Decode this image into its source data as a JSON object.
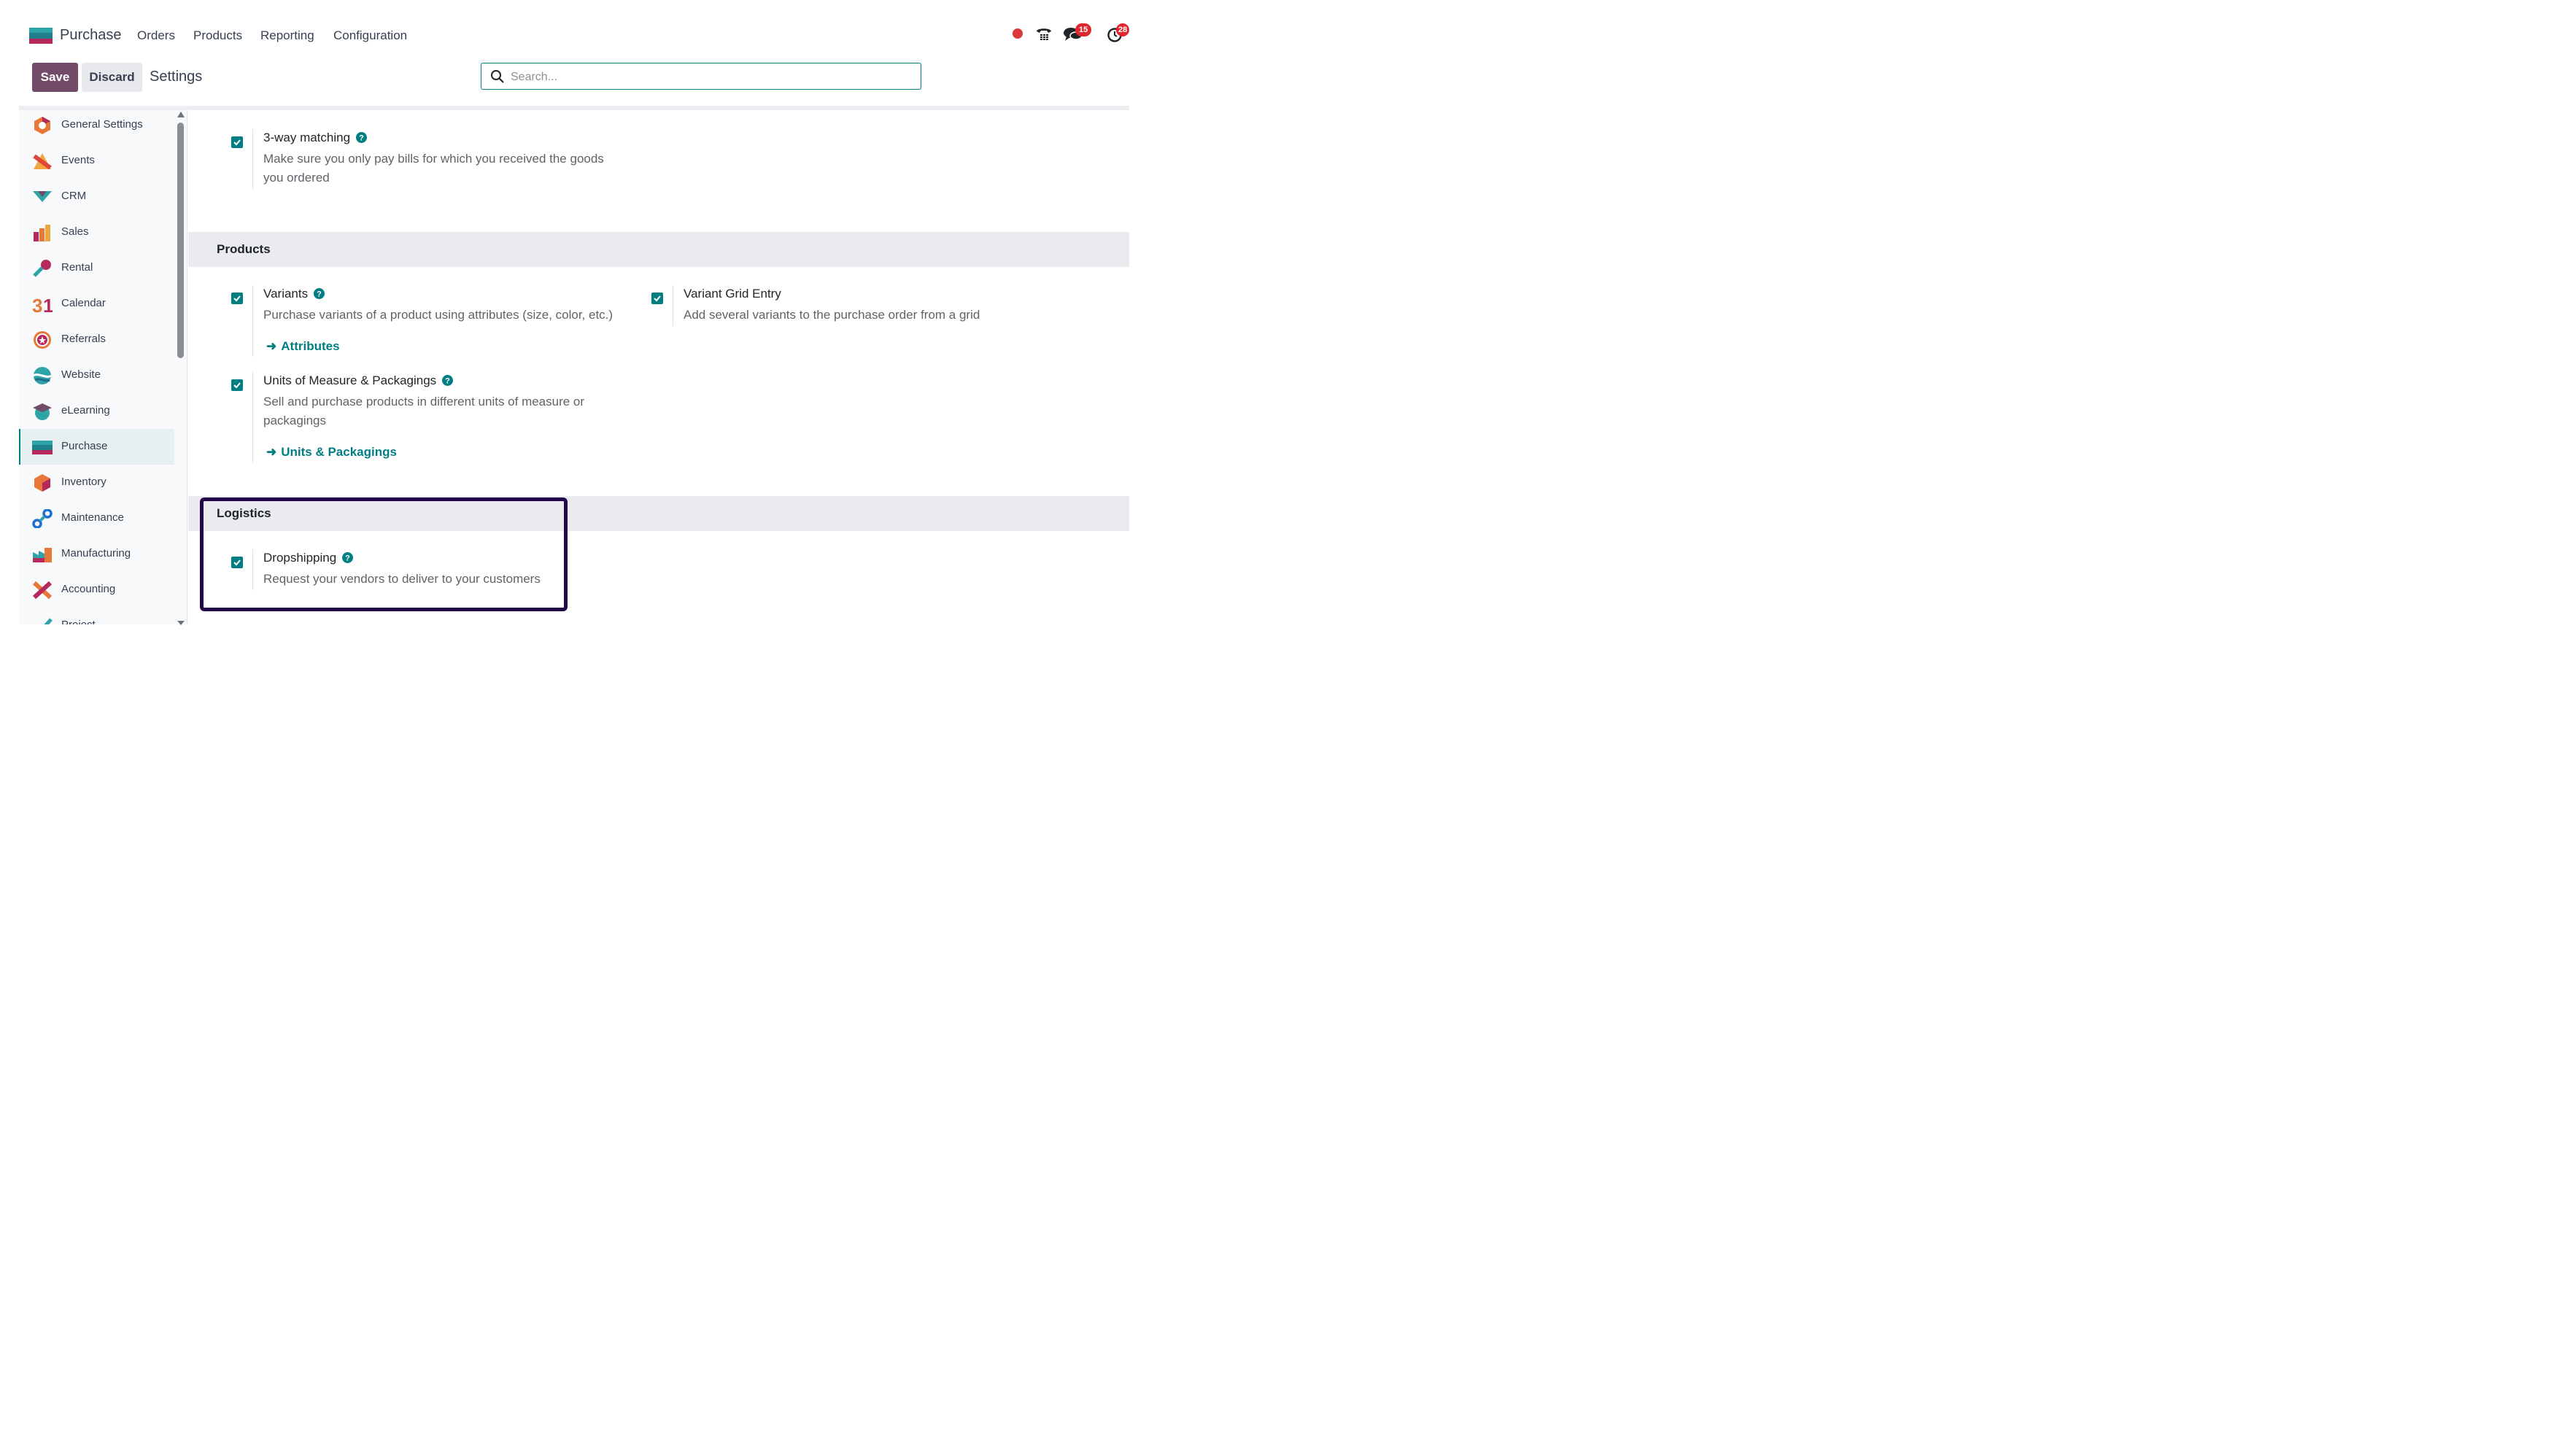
{
  "nav": {
    "app_name": "Purchase",
    "menu": [
      "Orders",
      "Products",
      "Reporting",
      "Configuration"
    ],
    "chat_badge": "15",
    "activity_badge": "28"
  },
  "controls": {
    "save_label": "Save",
    "discard_label": "Discard",
    "breadcrumb": "Settings",
    "search_placeholder": "Search..."
  },
  "sidebar": {
    "items": [
      {
        "label": "General Settings",
        "icon": "general-settings-icon"
      },
      {
        "label": "Events",
        "icon": "events-icon"
      },
      {
        "label": "CRM",
        "icon": "crm-icon"
      },
      {
        "label": "Sales",
        "icon": "sales-icon"
      },
      {
        "label": "Rental",
        "icon": "rental-icon"
      },
      {
        "label": "Calendar",
        "icon": "calendar-icon"
      },
      {
        "label": "Referrals",
        "icon": "referrals-icon"
      },
      {
        "label": "Website",
        "icon": "website-icon"
      },
      {
        "label": "eLearning",
        "icon": "elearning-icon"
      },
      {
        "label": "Purchase",
        "icon": "purchase-icon",
        "active": true
      },
      {
        "label": "Inventory",
        "icon": "inventory-icon"
      },
      {
        "label": "Maintenance",
        "icon": "maintenance-icon"
      },
      {
        "label": "Manufacturing",
        "icon": "manufacturing-icon"
      },
      {
        "label": "Accounting",
        "icon": "accounting-icon"
      },
      {
        "label": "Project",
        "icon": "project-icon"
      }
    ]
  },
  "settings": {
    "three_way": {
      "title": "3-way matching",
      "desc_line1": "Make sure you only pay bills for which you received the goods",
      "desc_line2": "you ordered",
      "checked": true
    },
    "products_section": "Products",
    "variants": {
      "title": "Variants",
      "desc": "Purchase variants of a product using attributes (size, color, etc.)",
      "link": "Attributes",
      "checked": true
    },
    "variant_grid": {
      "title": "Variant Grid Entry",
      "desc": "Add several variants to the purchase order from a grid",
      "checked": true
    },
    "uom": {
      "title": "Units of Measure & Packagings",
      "desc_line1": "Sell and purchase products in different units of measure or",
      "desc_line2": "packagings",
      "link": "Units & Packagings",
      "checked": true
    },
    "logistics_section": "Logistics",
    "dropshipping": {
      "title": "Dropshipping",
      "desc": "Request your vendors to deliver to your customers",
      "checked": true
    }
  },
  "colors": {
    "brand": "#714b67",
    "accent": "#017e84",
    "highlight": "#22084a",
    "badge": "#e2262e"
  }
}
